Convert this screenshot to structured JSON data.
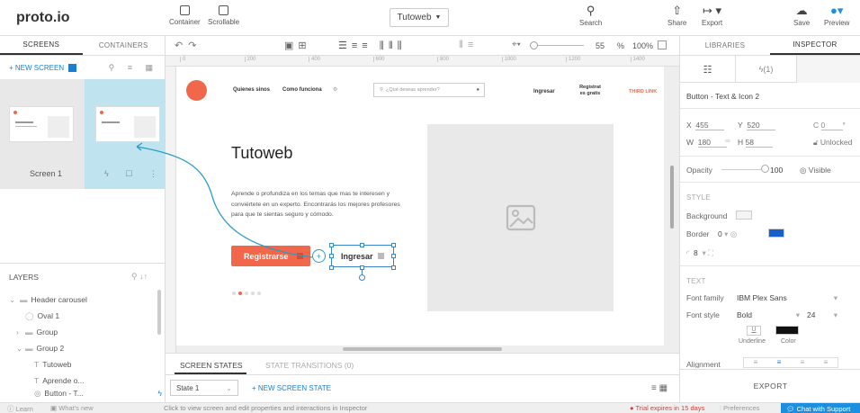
{
  "app": {
    "logo": "proto.io"
  },
  "toolbar": {
    "container": "Container",
    "scrollable": "Scrollable",
    "project_name": "Tutoweb",
    "search": "Search",
    "share": "Share",
    "export": "Export",
    "save": "Save",
    "preview": "Preview"
  },
  "left_tabs": {
    "screens": "SCREENS",
    "containers": "CONTAINERS"
  },
  "screens": {
    "new_screen": "+ NEW SCREEN",
    "screen1_label": "Screen 1"
  },
  "layers": {
    "title": "LAYERS",
    "items": [
      "Header carousel",
      "Oval 1",
      "Group",
      "Group 2",
      "Tutoweb",
      "Aprende o...",
      "Button - T..."
    ]
  },
  "editor_toolbar": {
    "zoom_value": "55",
    "zoom_unit": "%",
    "zoom_100": "100%"
  },
  "ruler": {
    "ticks": [
      "0",
      "200",
      "400",
      "600",
      "800",
      "1000",
      "1200",
      "1400"
    ]
  },
  "canvas": {
    "nav": {
      "link1": "Quienes sinos",
      "link2": "Como funciona",
      "search_placeholder": "¿Qué deseas aprender?",
      "login": "Ingresar",
      "register": "Registrat es gratis",
      "third": "THIRD LINK"
    },
    "hero": {
      "title": "Tutoweb",
      "body": "Aprende o profundiza en los temas que mas te interesen y conviértete en un experto. Encontrarás los mejores profesores para que te sientas seguro y cómodo.",
      "register_btn": "Registrarse",
      "login_btn": "Ingresar"
    }
  },
  "bottom": {
    "tab_states": "SCREEN STATES",
    "tab_transitions": "STATE TRANSITIONS (0)",
    "state_select": "State 1",
    "new_state": "+ NEW SCREEN STATE"
  },
  "right_tabs": {
    "libraries": "LIBRARIES",
    "inspector": "INSPECTOR"
  },
  "inspector": {
    "interactions_count": "(1)",
    "element_name": "Button - Text & Icon 2",
    "x_label": "X",
    "x": "455",
    "y_label": "Y",
    "y": "520",
    "c_label": "C",
    "c": "0",
    "w_label": "W",
    "w": "180",
    "h_label": "H",
    "h": "58",
    "lock": "Unlocked",
    "opacity_label": "Opacity",
    "opacity": "100",
    "visible": "Visible",
    "style_header": "STYLE",
    "background_label": "Background",
    "border_label": "Border",
    "border_value": "0",
    "radius_value": "8",
    "text_header": "TEXT",
    "font_family_label": "Font family",
    "font_family": "IBM Plex Sans",
    "font_style_label": "Font style",
    "font_style": "Bold",
    "font_size": "24",
    "underline": "Underline",
    "color": "Color",
    "alignment": "Alignment",
    "export_btn": "EXPORT"
  },
  "status": {
    "learn": "Learn",
    "whats_new": "What's new",
    "hint": "Click to view screen and edit properties and interactions in Inspector",
    "trial": "Trial expires in 15 days",
    "preferences": "Preferences",
    "chat": "Chat with Support"
  },
  "colors": {
    "accent": "#f0674b",
    "selection": "#bfe4ef",
    "link_blue": "#1a7fd0",
    "chat_bg": "#1d8fe0"
  }
}
